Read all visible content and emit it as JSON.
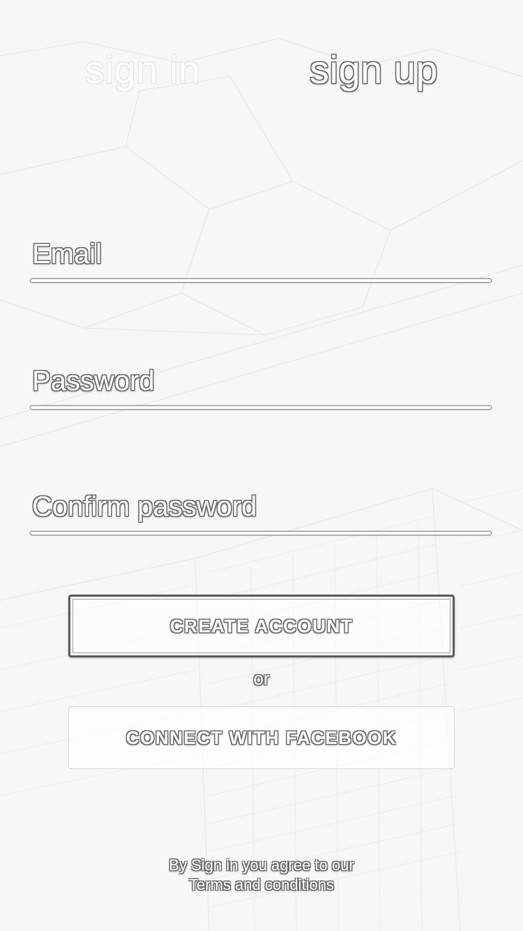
{
  "tabs": {
    "sign_in": "sign in",
    "sign_up": "sign up",
    "active": "sign up"
  },
  "form": {
    "email_label": "Email",
    "email_value": "",
    "password_label": "Password",
    "password_value": "",
    "confirm_label": "Confirm password",
    "confirm_value": ""
  },
  "buttons": {
    "create_account": "CREATE ACCOUNT",
    "separator": "or",
    "facebook": "CONNECT WITH FACEBOOK"
  },
  "footer": {
    "agree_text": "By Sign in you agree to our",
    "terms_link": "Terms and conditions"
  },
  "colors": {
    "background": "#f7f7f7",
    "outline": "#6b6b6b",
    "text_fill": "#ffffff"
  }
}
